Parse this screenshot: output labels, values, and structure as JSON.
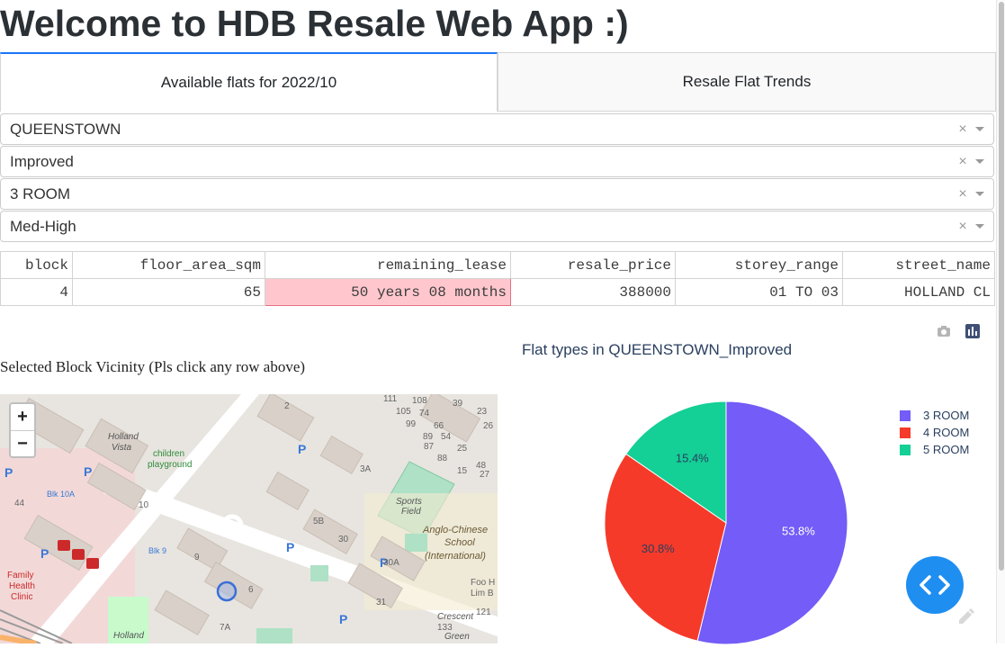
{
  "page_title": "Welcome to HDB Resale Web App :)",
  "tabs": [
    {
      "label": "Available flats for 2022/10",
      "active": true
    },
    {
      "label": "Resale Flat Trends",
      "active": false
    }
  ],
  "filters": [
    {
      "value": "QUEENSTOWN"
    },
    {
      "value": "Improved"
    },
    {
      "value": "3 ROOM"
    },
    {
      "value": "Med-High"
    }
  ],
  "filter_clear_glyph": "×",
  "table": {
    "columns": [
      "block",
      "floor_area_sqm",
      "remaining_lease",
      "resale_price",
      "storey_range",
      "street_name"
    ],
    "rows": [
      [
        "4",
        "65",
        "50 years 08 months",
        "388000",
        "01 TO 03",
        "HOLLAND CL"
      ]
    ]
  },
  "map": {
    "title": "Selected Block Vicinity (Pls click any row above)",
    "zoom_in": "+",
    "zoom_out": "−",
    "labels": {
      "holland_vista": "Holland\nVista",
      "children_playground": "children\nplayground",
      "sports_field": "Sports\nField",
      "school": "Anglo-Chinese\nSchool\n(International)",
      "blk_10a": "Blk 10A",
      "blk_9": "Blk 9",
      "family_health_clinic": "Family\nHealth\nClinic",
      "holland": "Holland",
      "crescent_green": "Crescent\nGreen",
      "foo_lim": "Foo H\nLim B"
    },
    "block_numbers": [
      "111",
      "108",
      "39",
      "105",
      "74",
      "23",
      "99",
      "66",
      "26",
      "89",
      "54",
      "87",
      "25",
      "88",
      "15",
      "81",
      "27",
      "2",
      "48",
      "1",
      "3A",
      "44",
      "10",
      "5B",
      "5",
      "30",
      "30A",
      "9",
      "6",
      "7A",
      "31",
      "133",
      "121",
      "9"
    ]
  },
  "chart_data": {
    "type": "pie",
    "title": "Flat types in QUEENSTOWN_Improved",
    "slices": [
      {
        "label": "3 ROOM",
        "value": 53.8,
        "text": "53.8%",
        "color": "#735cf7"
      },
      {
        "label": "4 ROOM",
        "value": 30.8,
        "text": "30.8%",
        "color": "#f53a2a"
      },
      {
        "label": "5 ROOM",
        "value": 15.4,
        "text": "15.4%",
        "color": "#14cf96"
      }
    ],
    "legend_position": "top-right"
  },
  "colors": {
    "accent_tab": "#1975fa",
    "highlight_cell": "#ffc7cd",
    "fab": "#1f8ef1",
    "chart_text": "#2a3f5f"
  },
  "icons": {
    "modebar": [
      "camera-icon",
      "plotly-logo-icon"
    ],
    "fab": "code-brackets-icon",
    "edit": "pencil-icon"
  }
}
